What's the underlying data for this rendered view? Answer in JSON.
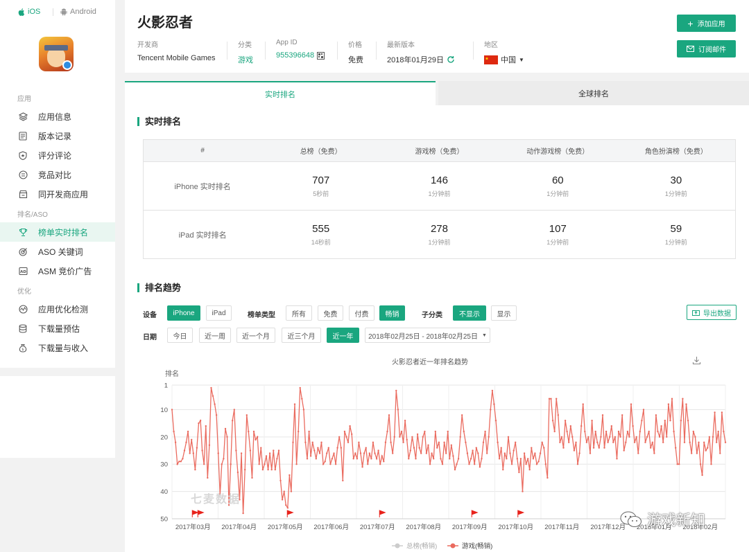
{
  "sidebar": {
    "platforms": [
      "iOS",
      "Android"
    ],
    "sections": {
      "app": "应用",
      "rank": "排名/ASO",
      "opt": "优化"
    },
    "items": [
      {
        "label": "应用信息",
        "icon": "layers-icon"
      },
      {
        "label": "版本记录",
        "icon": "document-icon"
      },
      {
        "label": "评分评论",
        "icon": "shield-star-icon"
      },
      {
        "label": "竞品对比",
        "icon": "compare-icon"
      },
      {
        "label": "同开发商应用",
        "icon": "store-icon"
      },
      {
        "label": "榜单实时排名",
        "icon": "trophy-icon"
      },
      {
        "label": "ASO 关键词",
        "icon": "target-icon"
      },
      {
        "label": "ASM 竞价广告",
        "icon": "ad-icon"
      },
      {
        "label": "应用优化检测",
        "icon": "monitor-icon"
      },
      {
        "label": "下载量预估",
        "icon": "database-icon"
      },
      {
        "label": "下载量与收入",
        "icon": "money-bag-icon"
      }
    ]
  },
  "header": {
    "title": "火影忍者",
    "developer_label": "开发商",
    "developer": "Tencent Mobile Games",
    "category_label": "分类",
    "category": "游戏",
    "appid_label": "App ID",
    "appid": "955396648",
    "price_label": "价格",
    "price": "免费",
    "version_label": "最新版本",
    "version": "2018年01月29日",
    "region_label": "地区",
    "region": "中国",
    "add_app": "添加应用",
    "subscribe": "订阅邮件"
  },
  "tabs": [
    "实时排名",
    "全球排名"
  ],
  "realtime": {
    "title": "实时排名",
    "headers": [
      "#",
      "总榜（免费）",
      "游戏榜（免费）",
      "动作游戏榜（免费）",
      "角色扮演榜（免费）"
    ],
    "rows": [
      {
        "label": "iPhone 实时排名",
        "cells": [
          {
            "rank": "707",
            "time": "5秒前"
          },
          {
            "rank": "146",
            "time": "1分钟前"
          },
          {
            "rank": "60",
            "time": "1分钟前"
          },
          {
            "rank": "30",
            "time": "1分钟前"
          }
        ]
      },
      {
        "label": "iPad 实时排名",
        "cells": [
          {
            "rank": "555",
            "time": "14秒前"
          },
          {
            "rank": "278",
            "time": "1分钟前"
          },
          {
            "rank": "107",
            "time": "1分钟前"
          },
          {
            "rank": "59",
            "time": "1分钟前"
          }
        ]
      }
    ]
  },
  "trend": {
    "title": "排名趋势",
    "device_label": "设备",
    "devices": [
      "iPhone",
      "iPad"
    ],
    "type_label": "榜单类型",
    "types": [
      "所有",
      "免费",
      "付费",
      "畅销"
    ],
    "sub_label": "子分类",
    "subs": [
      "不显示",
      "显示"
    ],
    "export": "导出数据",
    "date_label": "日期",
    "dates": [
      "今日",
      "近一周",
      "近一个月",
      "近三个月",
      "近一年"
    ],
    "range": "2018年02月25日 - 2018年02月25日"
  },
  "chart_data": {
    "type": "line",
    "title": "火影忍者近一年排名趋势",
    "ylabel": "排名",
    "y_ticks": [
      "1",
      "10",
      "20",
      "30",
      "40",
      "50"
    ],
    "ylim": [
      1,
      50
    ],
    "y_inverted": true,
    "x_ticks": [
      "2017年03月",
      "2017年04月",
      "2017年05月",
      "2017年06月",
      "2017年07月",
      "2017年08月",
      "2017年09月",
      "2017年10月",
      "2017年11月",
      "2017年12月",
      "2018年01月",
      "2018年02月"
    ],
    "series": [
      {
        "name": "总榜(畅销)",
        "color": "#cccccc",
        "values": []
      },
      {
        "name": "游戏(畅销)",
        "color": "#ea6a5e",
        "values": [
          10,
          18,
          22,
          30,
          29,
          29,
          28,
          25,
          22,
          18,
          26,
          21,
          26,
          32,
          24,
          15,
          14,
          25,
          30,
          16,
          35,
          23,
          2,
          5,
          8,
          12,
          26,
          41,
          30,
          28,
          17,
          20,
          45,
          30,
          14,
          10,
          25,
          33,
          43,
          26,
          48,
          32,
          12,
          18,
          25,
          35,
          18,
          21,
          20,
          30,
          24,
          32,
          30,
          27,
          32,
          26,
          32,
          25,
          32,
          28,
          25,
          36,
          43,
          40,
          45,
          46,
          34,
          40,
          22,
          8,
          30,
          18,
          2,
          6,
          10,
          22,
          28,
          18,
          27,
          22,
          25,
          28,
          24,
          26,
          22,
          30,
          29,
          26,
          24,
          30,
          28,
          26,
          30,
          24,
          20,
          24,
          36,
          18,
          20,
          22,
          16,
          19,
          28,
          26,
          28,
          22,
          26,
          31,
          26,
          24,
          30,
          26,
          28,
          22,
          26,
          28,
          25,
          30,
          27,
          29,
          22,
          18,
          12,
          22,
          26,
          20,
          3,
          10,
          20,
          18,
          22,
          14,
          21,
          28,
          25,
          20,
          24,
          28,
          19,
          24,
          26,
          20,
          18,
          26,
          23,
          30,
          26,
          28,
          18,
          24,
          22,
          28,
          30,
          22,
          26,
          18,
          28,
          23,
          27,
          32,
          30,
          28,
          20,
          12,
          18,
          22,
          26,
          30,
          28,
          25,
          30,
          24,
          26,
          31,
          28,
          22,
          18,
          26,
          20,
          10,
          3,
          8,
          14,
          22,
          28,
          24,
          32,
          26,
          28,
          20,
          26,
          30,
          25,
          22,
          28,
          33,
          28,
          40,
          26,
          30,
          28,
          32,
          24,
          28,
          26,
          30,
          29,
          26,
          22,
          24,
          30,
          35,
          6,
          6,
          14,
          18,
          6,
          12,
          22,
          20,
          24,
          14,
          18,
          22,
          16,
          20,
          25,
          22,
          30,
          26,
          16,
          8,
          18,
          22,
          20,
          26,
          14,
          24,
          18,
          22,
          24,
          20,
          12,
          24,
          18,
          22,
          20,
          16,
          22,
          20,
          28,
          18,
          20,
          12,
          25,
          22,
          18,
          20,
          8,
          16,
          22,
          20,
          26,
          18,
          14,
          10,
          22,
          20,
          18,
          24,
          22,
          26,
          12,
          18,
          20,
          16,
          22,
          14,
          20,
          8,
          14,
          6,
          18,
          24,
          30,
          30,
          14,
          6,
          22,
          8,
          14,
          22,
          26,
          18,
          20,
          26,
          22,
          30,
          34,
          22,
          25,
          24,
          20,
          30,
          20,
          11,
          22,
          18,
          26,
          11,
          18,
          22
        ]
      }
    ],
    "flags": [
      "2017年03月",
      "2017年03月",
      "2017年05月",
      "2017年07月",
      "2017年09月",
      "2017年10月"
    ]
  },
  "watermark": {
    "brand": "七麦数据",
    "channel": "游戏新知"
  }
}
